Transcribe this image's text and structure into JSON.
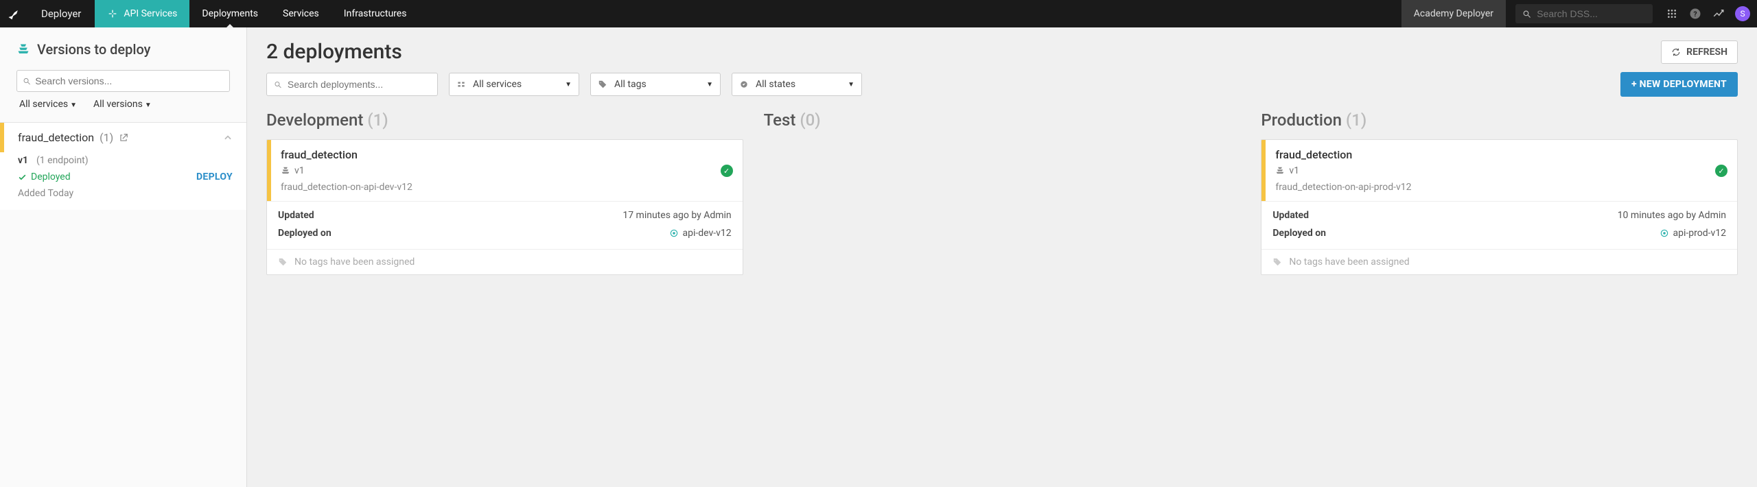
{
  "topbar": {
    "brand": "Deployer",
    "tabs": {
      "api_services": "API Services",
      "deployments": "Deployments",
      "services": "Services",
      "infrastructures": "Infrastructures"
    },
    "context": "Academy Deployer",
    "search_placeholder": "Search DSS...",
    "avatar_initial": "S"
  },
  "sidebar": {
    "title": "Versions to deploy",
    "search_placeholder": "Search versions...",
    "filter_services": "All services",
    "filter_versions": "All versions",
    "service": {
      "name": "fraud_detection",
      "count": "(1)",
      "version": "v1",
      "endpoint": "(1 endpoint)",
      "deployed_label": "Deployed",
      "deploy_btn": "DEPLOY",
      "added": "Added Today"
    }
  },
  "main": {
    "title": "2 deployments",
    "refresh": "REFRESH",
    "search_placeholder": "Search deployments...",
    "dd_services": "All services",
    "dd_tags": "All tags",
    "dd_states": "All states",
    "new_deployment": "+ NEW DEPLOYMENT",
    "no_tags": "No tags have been assigned",
    "updated_label": "Updated",
    "deployed_on_label": "Deployed on",
    "columns": {
      "dev": {
        "title": "Development",
        "count": "(1)"
      },
      "test": {
        "title": "Test",
        "count": "(0)"
      },
      "prod": {
        "title": "Production",
        "count": "(1)"
      }
    },
    "dev_card": {
      "title": "fraud_detection",
      "version": "v1",
      "url": "fraud_detection-on-api-dev-v12",
      "updated": "17 minutes ago by Admin",
      "infra": "api-dev-v12"
    },
    "prod_card": {
      "title": "fraud_detection",
      "version": "v1",
      "url": "fraud_detection-on-api-prod-v12",
      "updated": "10 minutes ago by Admin",
      "infra": "api-prod-v12"
    }
  }
}
